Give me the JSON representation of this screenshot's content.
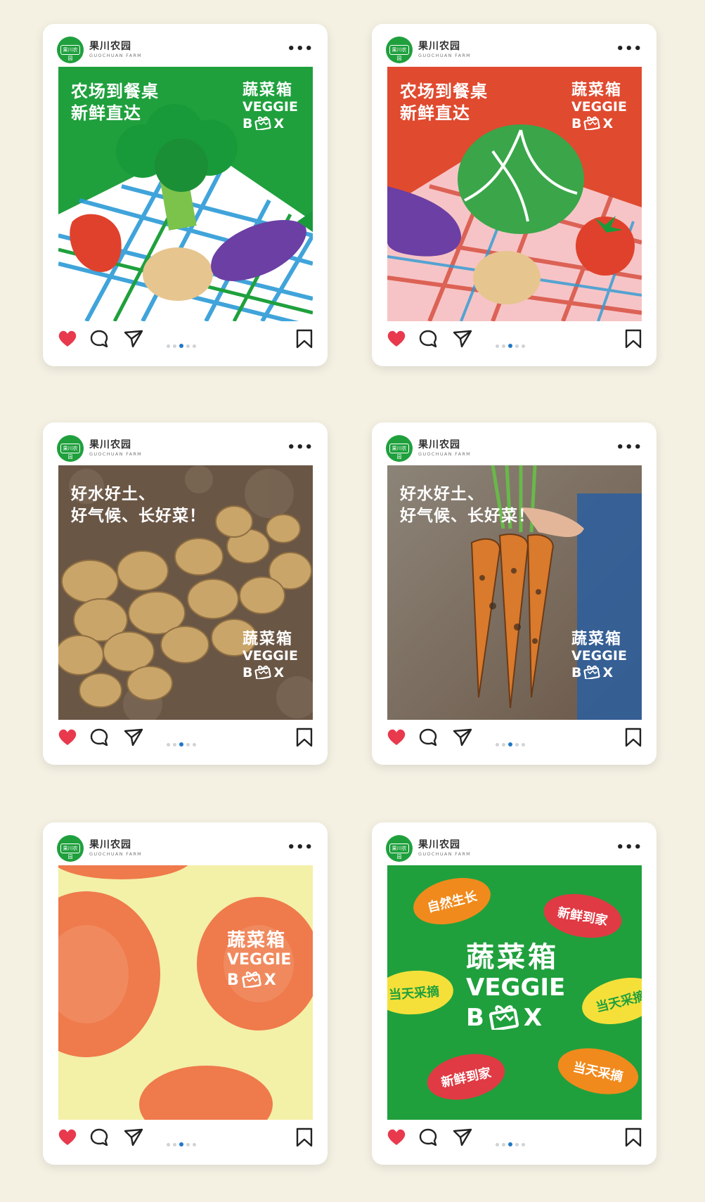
{
  "brand": {
    "name_cn": "果川农园",
    "name_en": "GUOCHUAN FARM",
    "logo_text": "果川农园"
  },
  "menu_glyph": "•••",
  "veggie_box": {
    "cn": "蔬菜箱",
    "en_line1": "VEGGIE",
    "en_b": "B",
    "en_x": "X"
  },
  "posts": [
    {
      "headline_1": "农场到餐桌",
      "headline_2": "新鲜直达",
      "liked": true,
      "active_dot": 3
    },
    {
      "headline_1": "农场到餐桌",
      "headline_2": "新鲜直达",
      "liked": true,
      "active_dot": 3
    },
    {
      "headline_1": "好水好土、",
      "headline_2": "好气候、长好菜！",
      "liked": true,
      "active_dot": 3
    },
    {
      "headline_1": "好水好土、",
      "headline_2": "好气候、长好菜！",
      "liked": true,
      "active_dot": 3
    },
    {
      "liked": true,
      "active_dot": 3
    },
    {
      "stickers": [
        "自然生长",
        "新鲜到家",
        "当天采摘",
        "当天采摘",
        "新鲜到家",
        "当天采摘"
      ],
      "liked": true,
      "active_dot": 3
    }
  ],
  "colors": {
    "green": "#1fa03d",
    "red": "#e04a2f",
    "heart": "#e8394d",
    "dot_active": "#1f78c9"
  },
  "icons": [
    "heart-icon",
    "comment-icon",
    "share-icon",
    "bookmark-icon",
    "more-icon"
  ]
}
